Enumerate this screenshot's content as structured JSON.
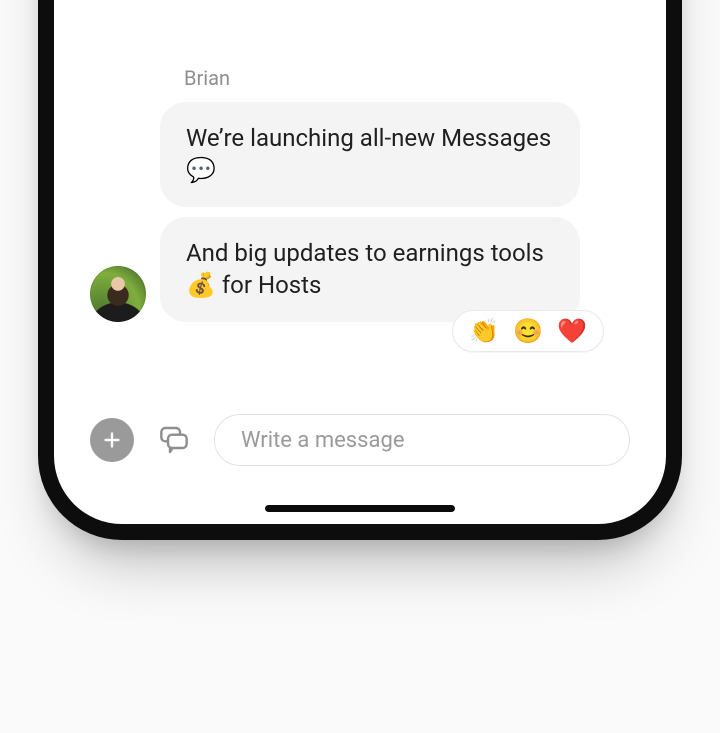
{
  "sender": "Brian",
  "messages": [
    {
      "text": "We’re launching all-new Messages 💬"
    },
    {
      "text": "And big updates to earnings tools 💰 for Hosts"
    }
  ],
  "reactions": [
    "👏",
    "😊",
    "❤️"
  ],
  "composer": {
    "placeholder": "Write a message"
  }
}
